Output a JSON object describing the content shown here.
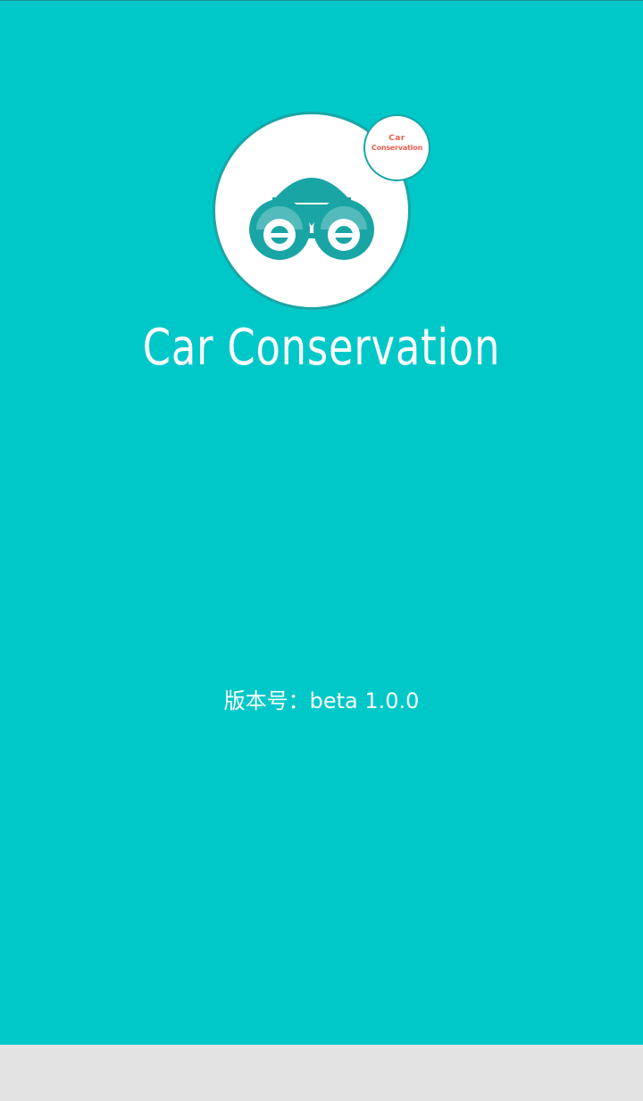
{
  "app": {
    "title": "Car Conservation",
    "version_text": "版本号：beta 1.0.0"
  },
  "logo": {
    "icon": "car-icon",
    "badge_line1": "Car",
    "badge_line2": "Conservation"
  },
  "colors": {
    "background": "#00c8c9",
    "logo_accent": "#1aa5a5",
    "badge_text": "#e8614f",
    "bottom_bar": "#e3e3e3"
  }
}
